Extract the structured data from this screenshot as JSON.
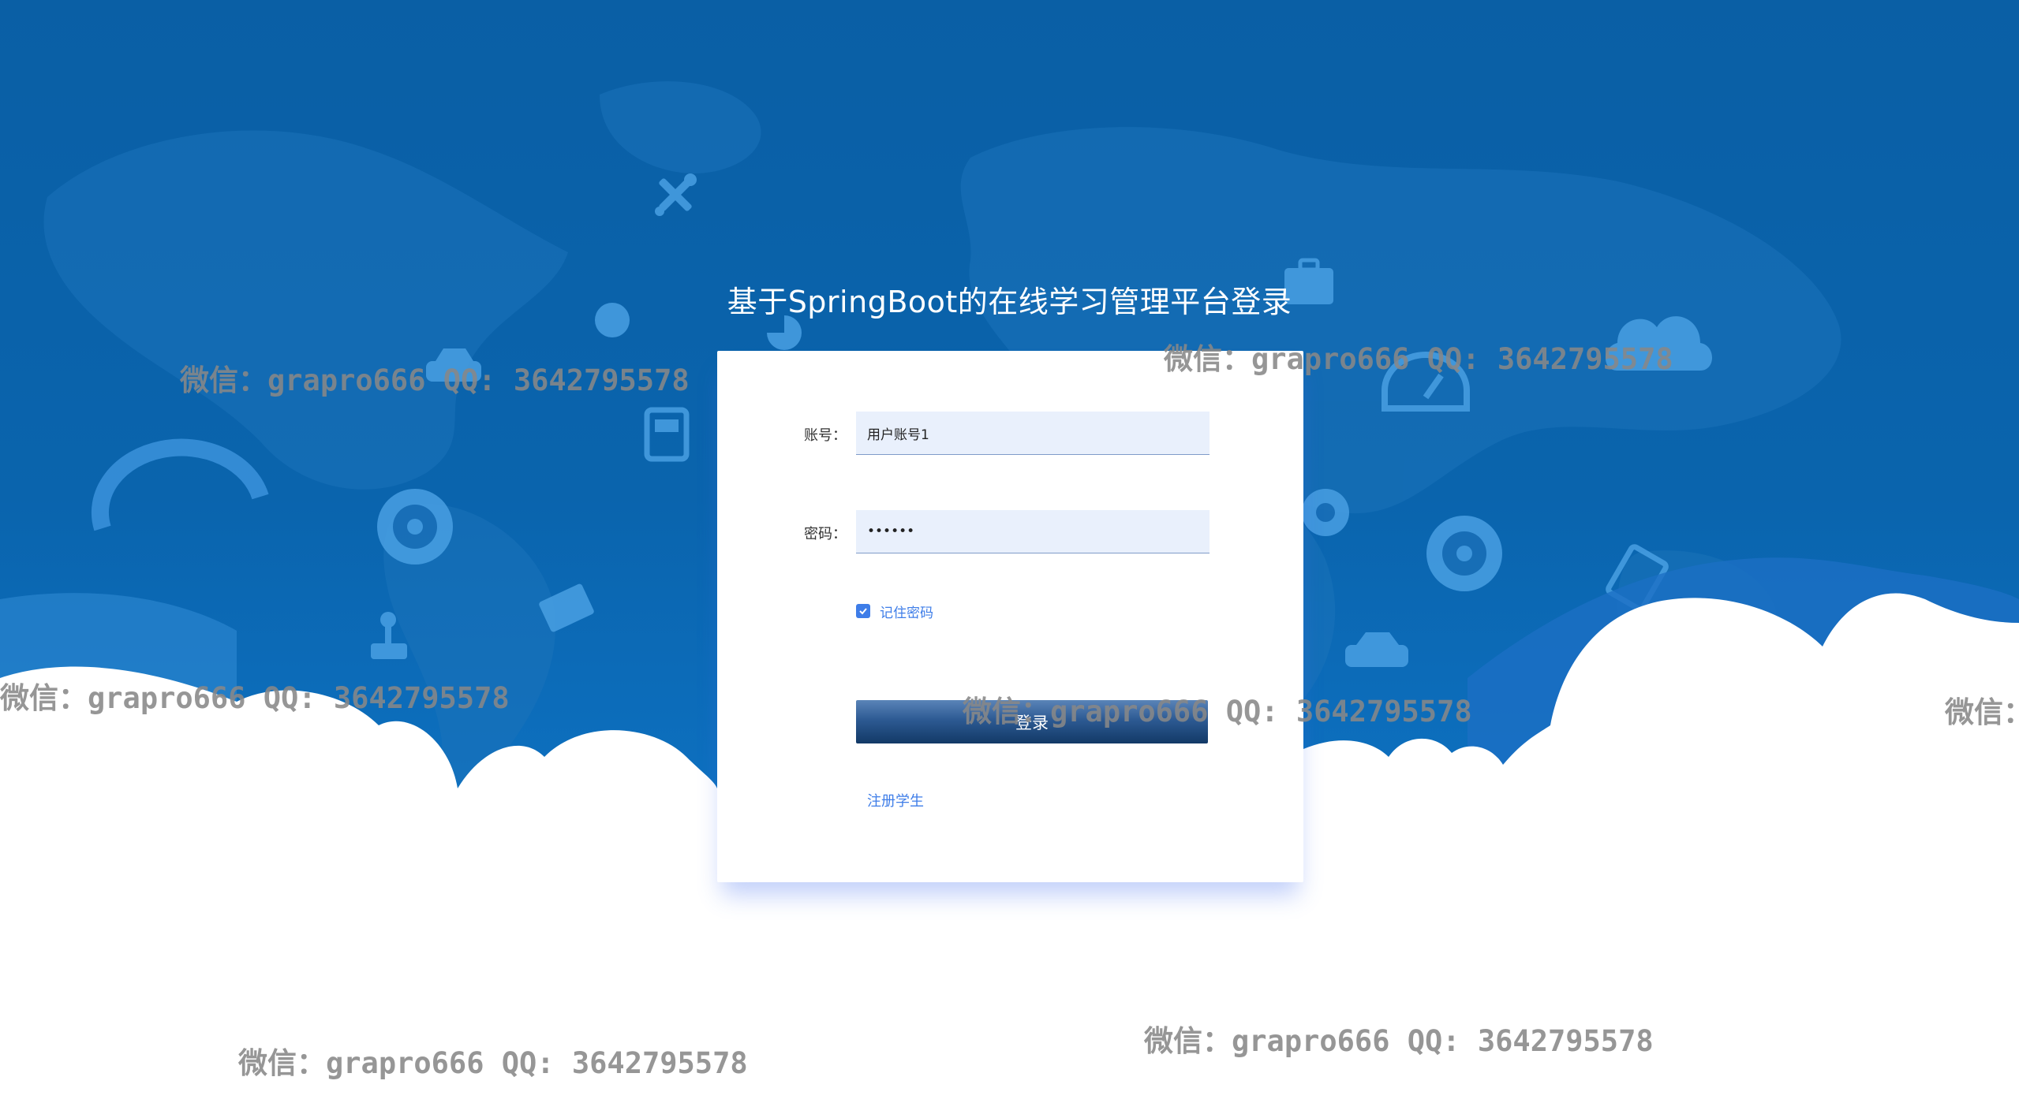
{
  "page": {
    "title": "基于SpringBoot的在线学习管理平台登录"
  },
  "form": {
    "username_label": "账号：",
    "username_value": "用户账号1",
    "password_label": "密码：",
    "password_value": "123456",
    "remember_label": "记住密码",
    "remember_checked": true,
    "login_button": "登录",
    "register_link": "注册学生"
  },
  "watermarks": [
    "微信：grapro666 QQ: 3642795578",
    "微信：grapro666 QQ: 3642795578",
    "微信：grapro666 QQ: 3642795578",
    "微信：grapro666 QQ: 3642795578",
    "微信：",
    "微信：grapro666 QQ: 3642795578",
    "微信：grapro666 QQ: 3642795578"
  ],
  "colors": {
    "background": "#0a64ad",
    "accent": "#3e7de8",
    "button": "#2d5a93",
    "input_background": "#e9f0fc"
  },
  "icons": [
    "tools-icon",
    "briefcase-icon",
    "globe-icon",
    "pie-chart-icon",
    "car-icon",
    "cloud-icon",
    "dashboard-icon",
    "fuel-pump-icon",
    "speedometer-icon",
    "wheel-icon",
    "gear-icon",
    "envelope-icon",
    "joystick-icon",
    "car-icon",
    "document-icon"
  ]
}
